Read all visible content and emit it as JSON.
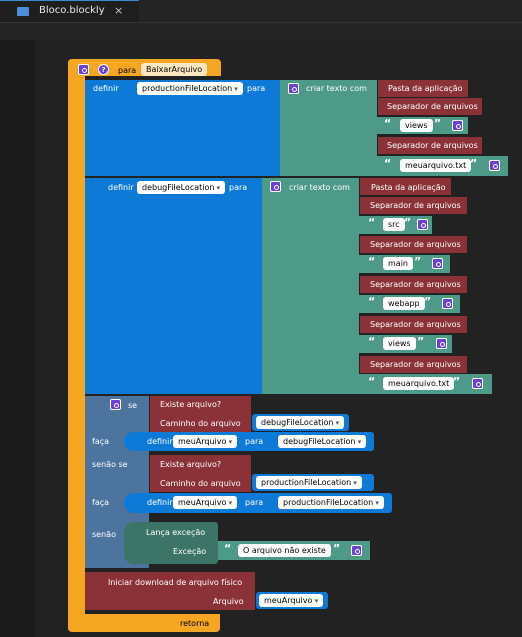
{
  "tab": {
    "title": "Bloco.blockly",
    "close": "×"
  },
  "proc": {
    "para": "para",
    "name": "BaixarArquivo",
    "retorna": "retorna"
  },
  "def1": {
    "definir": "definir",
    "var": "productionFileLocation",
    "para": "para",
    "criar": "criar texto com",
    "items": [
      "Pasta da aplicação",
      "Separador de arquivos",
      "views",
      "Separador de arquivos",
      "meuarquivo.txt"
    ]
  },
  "def2": {
    "definir": "definir",
    "var": "debugFileLocation",
    "para": "para",
    "criar": "criar texto com",
    "items": [
      "Pasta da aplicação",
      "Separador de arquivos",
      "src",
      "Separador de arquivos",
      "main",
      "Separador de arquivos",
      "webapp",
      "Separador de arquivos",
      "views",
      "Separador de arquivos",
      "meuarquivo.txt"
    ]
  },
  "ifblock": {
    "se": "se",
    "faca1": "faça",
    "senaose": "senão se",
    "faca2": "faça",
    "senao": "senão",
    "exists1": "Existe arquivo?",
    "path1": "Caminho do arquivo",
    "pathvar1": "debugFileLocation",
    "set1": "definir",
    "setvar1": "meuArquivo",
    "setpara1": "para",
    "setval1": "debugFileLocation",
    "exists2": "Existe arquivo?",
    "path2": "Caminho do arquivo",
    "pathvar2": "productionFileLocation",
    "set2": "definir",
    "setvar2": "meuArquivo",
    "setpara2": "para",
    "setval2": "productionFileLocation",
    "throw": "Lança exceção",
    "exc": "Exceção",
    "excmsg": "O arquivo não existe"
  },
  "download": {
    "label": "Iniciar download de arquivo físico",
    "arq": "Arquivo",
    "var": "meuArquivo"
  },
  "colors": {
    "procedure": "#f5a623",
    "variables": "#0e7ad8",
    "text": "#4c9a87",
    "file": "#8a3237",
    "logic": "#4d739f"
  }
}
